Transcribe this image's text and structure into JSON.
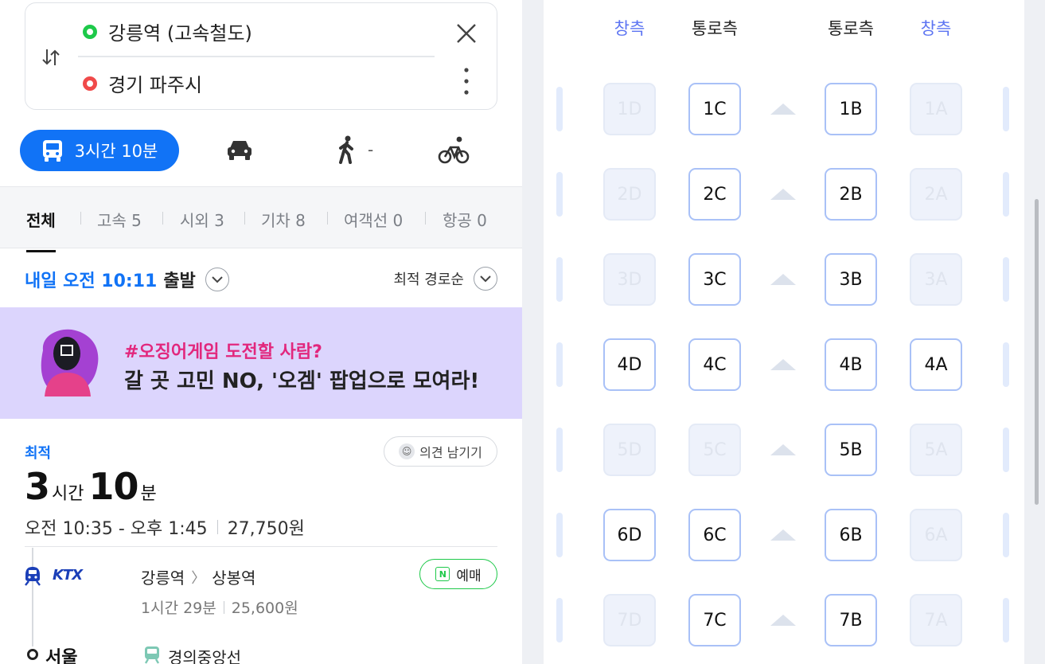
{
  "route": {
    "from": "강릉역 (고속철도)",
    "to": "경기 파주시"
  },
  "modes": {
    "transit_label": "3시간 10분",
    "walk_label": "-"
  },
  "tabs": [
    {
      "label": "전체"
    },
    {
      "label": "고속 5"
    },
    {
      "label": "시외 3"
    },
    {
      "label": "기차 8"
    },
    {
      "label": "여객선 0"
    },
    {
      "label": "항공 0"
    }
  ],
  "departure": {
    "time_label": "내일 오전 10:11",
    "suffix": "출발",
    "sort_label": "최적 경로순"
  },
  "banner": {
    "line1": "#오징어게임 도전할 사람?",
    "line2": "갈 곳 고민 NO, '오겜' 팝업으로 모여라!"
  },
  "result": {
    "badge": "최적",
    "feedback_label": "의견 남기기",
    "hours": "3",
    "hours_unit": "시간",
    "minutes": "10",
    "minutes_unit": "분",
    "time_range": "오전 10:35 - 오후 1:45",
    "fare": "27,750원",
    "segment": {
      "carrier_logo_text": "KTX",
      "from": "강릉역",
      "to": "상봉역",
      "duration": "1시간 29분",
      "fare": "25,600원",
      "booking_label": "예매",
      "booking_badge": "N"
    },
    "transfer": {
      "station": "서울",
      "line": "경의중앙선"
    }
  },
  "seat_map": {
    "headers": [
      "창측",
      "통로측",
      "통로측",
      "창측"
    ],
    "rows": [
      {
        "seats": [
          {
            "id": "1D",
            "available": false
          },
          {
            "id": "1C",
            "available": true
          },
          {
            "id": "1B",
            "available": true
          },
          {
            "id": "1A",
            "available": false
          }
        ]
      },
      {
        "seats": [
          {
            "id": "2D",
            "available": false
          },
          {
            "id": "2C",
            "available": true
          },
          {
            "id": "2B",
            "available": true
          },
          {
            "id": "2A",
            "available": false
          }
        ]
      },
      {
        "seats": [
          {
            "id": "3D",
            "available": false
          },
          {
            "id": "3C",
            "available": true
          },
          {
            "id": "3B",
            "available": true
          },
          {
            "id": "3A",
            "available": false
          }
        ]
      },
      {
        "seats": [
          {
            "id": "4D",
            "available": true
          },
          {
            "id": "4C",
            "available": true
          },
          {
            "id": "4B",
            "available": true
          },
          {
            "id": "4A",
            "available": true
          }
        ]
      },
      {
        "seats": [
          {
            "id": "5D",
            "available": false
          },
          {
            "id": "5C",
            "available": false
          },
          {
            "id": "5B",
            "available": true
          },
          {
            "id": "5A",
            "available": false
          }
        ]
      },
      {
        "seats": [
          {
            "id": "6D",
            "available": true
          },
          {
            "id": "6C",
            "available": true
          },
          {
            "id": "6B",
            "available": true
          },
          {
            "id": "6A",
            "available": false
          }
        ]
      },
      {
        "seats": [
          {
            "id": "7D",
            "available": false
          },
          {
            "id": "7C",
            "available": true
          },
          {
            "id": "7B",
            "available": true
          },
          {
            "id": "7A",
            "available": false
          }
        ]
      }
    ]
  },
  "colors": {
    "accent": "#1173f6",
    "window_header": "#5c74f2",
    "origin_dot": "#1ec94a",
    "destination_dot": "#f04a4a",
    "banner_bg": "#dcd5fd",
    "banner_highlight": "#e2277d"
  },
  "icons": [
    "swap-icon",
    "close-icon",
    "more-icon",
    "bus-icon",
    "car-icon",
    "walk-icon",
    "bike-icon",
    "chevron-down-icon",
    "smile-icon",
    "train-icon",
    "naver-icon"
  ]
}
